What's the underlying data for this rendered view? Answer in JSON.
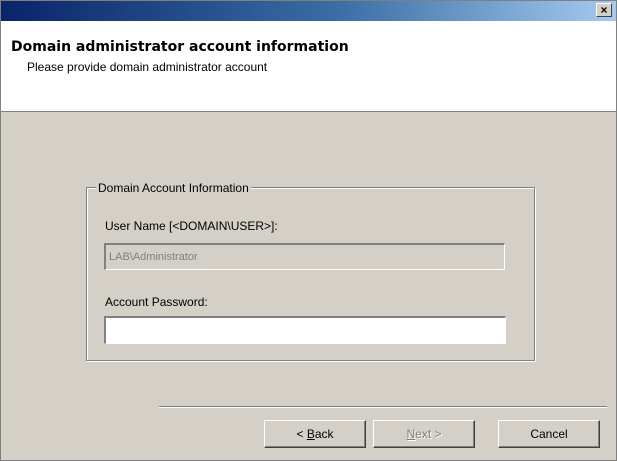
{
  "titlebar": {
    "close_label": "×"
  },
  "header": {
    "title": "Domain administrator account information",
    "subtitle": "Please provide domain administrator account"
  },
  "group": {
    "legend": "Domain Account Information",
    "username": {
      "label": "User Name [<DOMAIN\\USER>]:",
      "value": "LAB\\Administrator",
      "disabled": true
    },
    "password": {
      "label": "Account Password:",
      "value": ""
    }
  },
  "buttons": {
    "back": {
      "prefix": "< ",
      "accel": "B",
      "rest": "ack"
    },
    "next": {
      "accel": "N",
      "rest": "ext >",
      "disabled": true
    },
    "cancel": {
      "label": "Cancel"
    }
  }
}
